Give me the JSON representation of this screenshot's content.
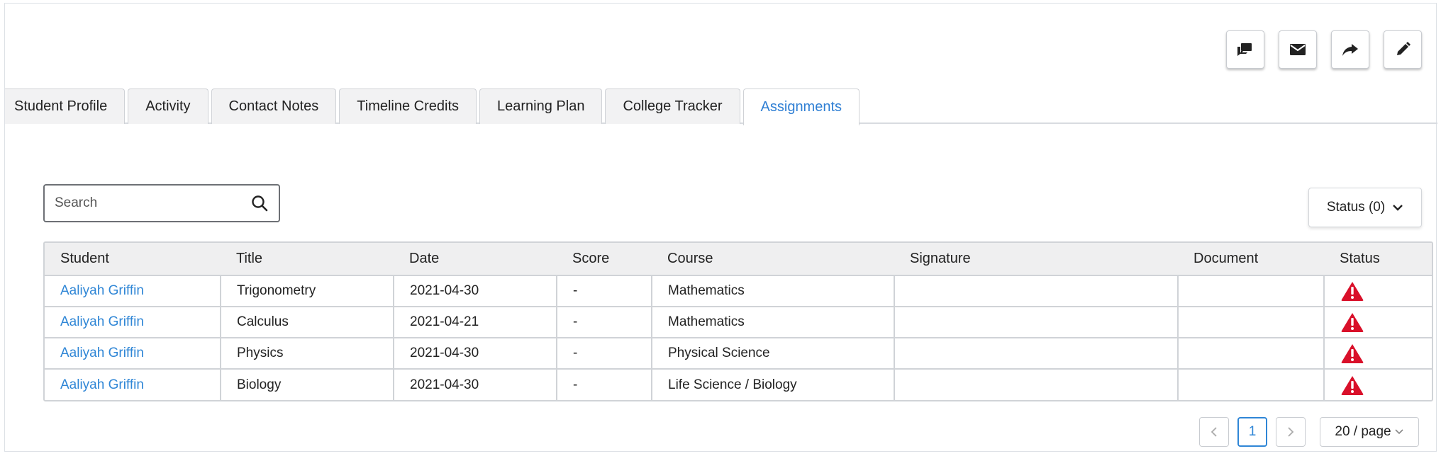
{
  "actions": [
    {
      "name": "chat-icon"
    },
    {
      "name": "mail-icon"
    },
    {
      "name": "share-icon"
    },
    {
      "name": "edit-icon"
    }
  ],
  "tabs": [
    {
      "label": "Student Profile",
      "active": false
    },
    {
      "label": "Activity",
      "active": false
    },
    {
      "label": "Contact Notes",
      "active": false
    },
    {
      "label": "Timeline Credits",
      "active": false
    },
    {
      "label": "Learning Plan",
      "active": false
    },
    {
      "label": "College Tracker",
      "active": false
    },
    {
      "label": "Assignments",
      "active": true
    }
  ],
  "search": {
    "placeholder": "Search",
    "value": ""
  },
  "status_filter": {
    "label": "Status (0)"
  },
  "table": {
    "columns": [
      "Student",
      "Title",
      "Date",
      "Score",
      "Course",
      "Signature",
      "Document",
      "Status"
    ],
    "rows": [
      {
        "student": "Aaliyah Griffin",
        "title": "Trigonometry",
        "date": "2021-04-30",
        "score": "-",
        "course": "Mathematics",
        "signature": "",
        "document": "",
        "status": "warning-icon"
      },
      {
        "student": "Aaliyah Griffin",
        "title": "Calculus",
        "date": "2021-04-21",
        "score": "-",
        "course": "Mathematics",
        "signature": "",
        "document": "",
        "status": "warning-icon"
      },
      {
        "student": "Aaliyah Griffin",
        "title": "Physics",
        "date": "2021-04-30",
        "score": "-",
        "course": "Physical Science",
        "signature": "",
        "document": "",
        "status": "warning-icon"
      },
      {
        "student": "Aaliyah Griffin",
        "title": "Biology",
        "date": "2021-04-30",
        "score": "-",
        "course": "Life Science / Biology",
        "signature": "",
        "document": "",
        "status": "warning-icon"
      }
    ]
  },
  "pagination": {
    "prev": "<",
    "current": "1",
    "next": ">",
    "page_size": "20 / page"
  },
  "colors": {
    "accent": "#2f86d6",
    "warning": "#d9102a"
  }
}
